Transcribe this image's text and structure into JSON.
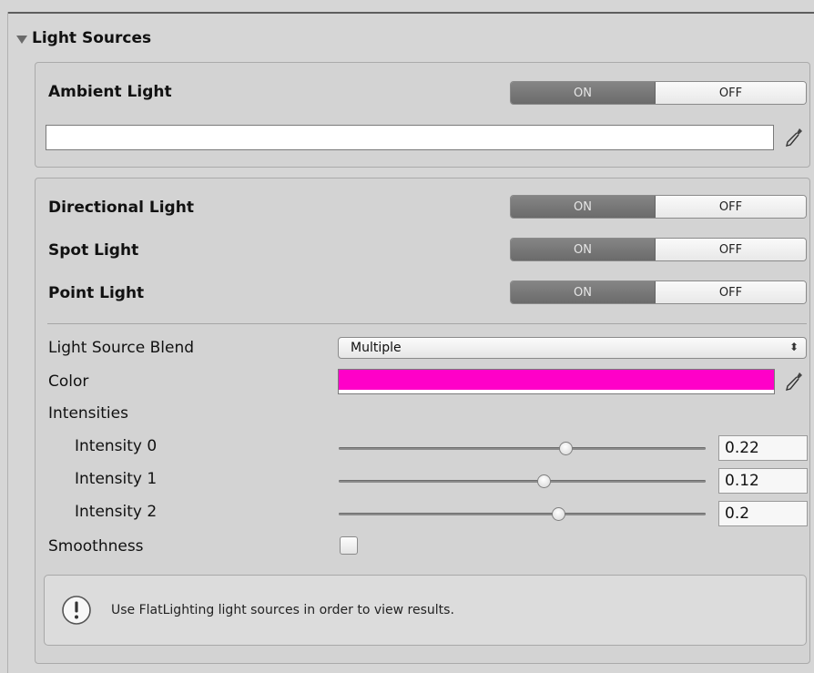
{
  "section": {
    "title": "Light Sources",
    "expanded": true
  },
  "ambient": {
    "label": "Ambient Light",
    "toggle": {
      "on_label": "ON",
      "off_label": "OFF",
      "state": "ON"
    },
    "color": "#ffffff"
  },
  "lights": [
    {
      "label": "Directional Light",
      "on_label": "ON",
      "off_label": "OFF",
      "state": "ON"
    },
    {
      "label": "Spot Light",
      "on_label": "ON",
      "off_label": "OFF",
      "state": "ON"
    },
    {
      "label": "Point Light",
      "on_label": "ON",
      "off_label": "OFF",
      "state": "ON"
    }
  ],
  "blend": {
    "label": "Light Source Blend",
    "value": "Multiple",
    "arrows": "⬍"
  },
  "color": {
    "label": "Color",
    "value": "#ff00c8"
  },
  "intensities": {
    "label": "Intensities",
    "items": [
      {
        "label": "Intensity 0",
        "value": "0.22",
        "slider_fraction": 0.62
      },
      {
        "label": "Intensity 1",
        "value": "0.12",
        "slider_fraction": 0.56
      },
      {
        "label": "Intensity 2",
        "value": "0.2",
        "slider_fraction": 0.6
      }
    ]
  },
  "smoothness": {
    "label": "Smoothness",
    "checked": false
  },
  "help": {
    "icon": "info-icon",
    "text": "Use FlatLighting light sources in order to view results."
  }
}
